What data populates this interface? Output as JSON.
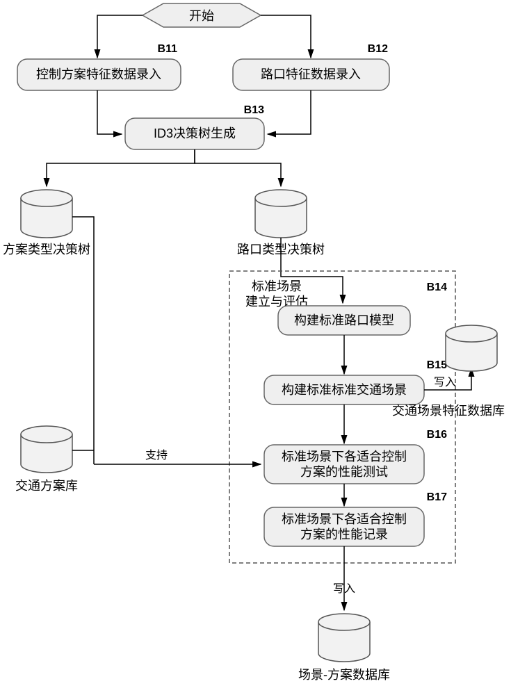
{
  "start": "开始",
  "steps": {
    "b11": {
      "id": "B11",
      "label": "控制方案特征数据录入"
    },
    "b12": {
      "id": "B12",
      "label": "路口特征数据录入"
    },
    "b13": {
      "id": "B13",
      "label": "ID3决策树生成"
    },
    "b14": {
      "id": "B14",
      "label": "构建标准路口模型"
    },
    "b15": {
      "id": "B15",
      "label": "构建标准标准交通场景"
    },
    "b16": {
      "id": "B16",
      "line1": "标准场景下各适合控制",
      "line2": "方案的性能测试"
    },
    "b17": {
      "id": "B17",
      "line1": "标准场景下各适合控制",
      "line2": "方案的性能记录"
    }
  },
  "group": {
    "title_line1": "标准场景",
    "title_line2": "建立与评估"
  },
  "dbs": {
    "scheme_tree": "方案类型决策树",
    "intersection_tree": "路口类型决策树",
    "traffic_scheme_lib": "交通方案库",
    "scene_feature_db": "交通场景特征数据库",
    "scene_scheme_db": "场景-方案数据库"
  },
  "edges": {
    "write1": "写入",
    "write2": "写入",
    "support": "支持"
  }
}
